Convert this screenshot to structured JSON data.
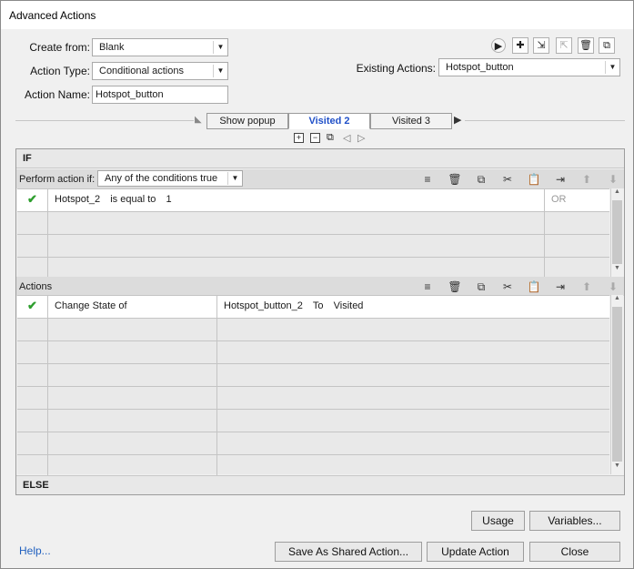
{
  "window": {
    "title": "Advanced Actions"
  },
  "form": {
    "create_from_label": "Create from:",
    "create_from_value": "Blank",
    "action_type_label": "Action Type:",
    "action_type_value": "Conditional actions",
    "action_name_label": "Action Name:",
    "action_name_value": "Hotspot_button",
    "existing_actions_label": "Existing Actions:",
    "existing_actions_value": "Hotspot_button"
  },
  "toolbar_icons": [
    "play-preview-icon",
    "add-action-icon",
    "import-action-icon",
    "export-action-icon",
    "delete-action-icon",
    "duplicate-action-icon"
  ],
  "decision_tabs": [
    {
      "label": "Show popup",
      "active": false
    },
    {
      "label": "Visited 2",
      "active": true
    },
    {
      "label": "Visited 3",
      "active": false
    }
  ],
  "decision_controls": [
    "add-decision-icon",
    "remove-decision-icon",
    "copy-decision-icon",
    "previous-decision-icon",
    "next-decision-icon"
  ],
  "if_section": {
    "header": "IF",
    "perform_label": "Perform action if:",
    "perform_value": "Any of the conditions true",
    "conditions": [
      {
        "checked": true,
        "variable": "Hotspot_2",
        "operator": "is equal to",
        "value": "1",
        "logic": "OR"
      }
    ]
  },
  "actions_section": {
    "header": "Actions",
    "rows": [
      {
        "checked": true,
        "action": "Change State of",
        "target": "Hotspot_button_2",
        "to_label": "To",
        "state": "Visited"
      }
    ]
  },
  "grid_icons": [
    "insert-row-icon",
    "delete-row-icon",
    "copy-row-icon",
    "cut-row-icon",
    "paste-row-icon",
    "insert-below-icon",
    "move-up-icon",
    "move-down-icon"
  ],
  "else_section": {
    "header": "ELSE"
  },
  "buttons": {
    "usage": "Usage",
    "variables": "Variables...",
    "help": "Help...",
    "save_shared": "Save As Shared Action...",
    "update": "Update Action",
    "close": "Close"
  }
}
